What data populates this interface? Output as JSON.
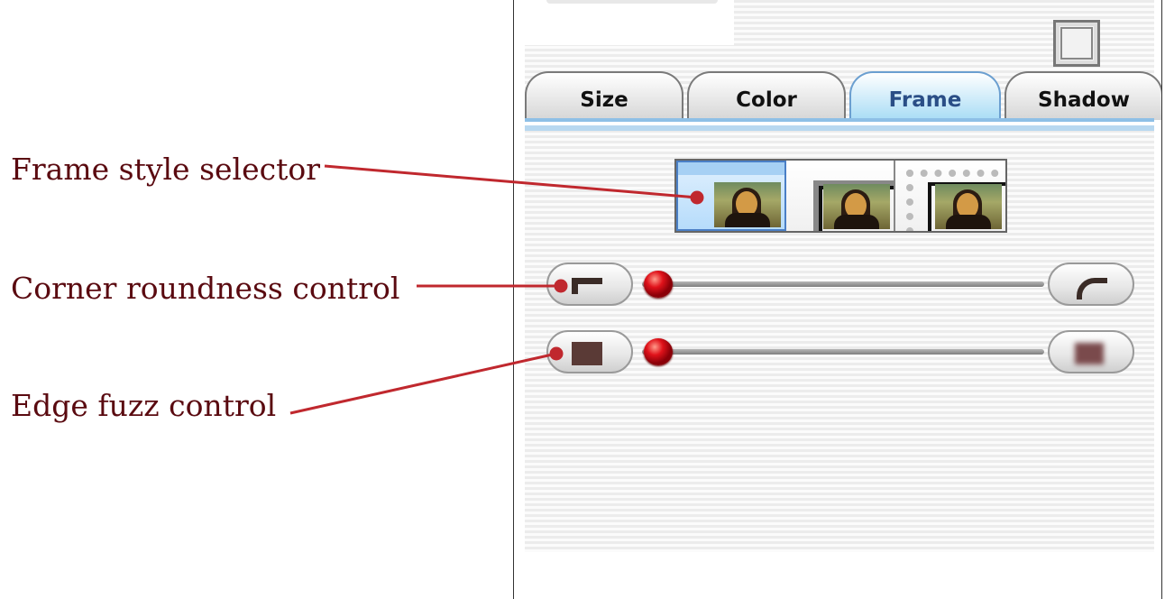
{
  "callouts": {
    "frame_style": "Frame style selector",
    "corner_roundness": "Corner roundness control",
    "edge_fuzz": "Edge fuzz control"
  },
  "tabs": [
    {
      "label": "Size",
      "active": false
    },
    {
      "label": "Color",
      "active": false
    },
    {
      "label": "Frame",
      "active": true
    },
    {
      "label": "Shadow",
      "active": false
    }
  ],
  "frame_styles": [
    {
      "icon": "no-frame-thumbnail-icon",
      "selected": true
    },
    {
      "icon": "square-frame-thumbnail-icon",
      "selected": false
    },
    {
      "icon": "stamp-frame-thumbnail-icon",
      "selected": false
    }
  ],
  "sliders": {
    "corner_roundness": {
      "value": 0.0,
      "min_icon": "square-corner-icon",
      "max_icon": "round-corner-icon"
    },
    "edge_fuzz": {
      "value": 0.0,
      "min_icon": "sharp-edge-square-icon",
      "max_icon": "fuzzy-edge-square-icon"
    }
  },
  "colors": {
    "callout_text": "#5a0a10",
    "callout_line": "#c0282e",
    "active_tab_text": "#2a4e86",
    "knob": "#e0121a"
  }
}
